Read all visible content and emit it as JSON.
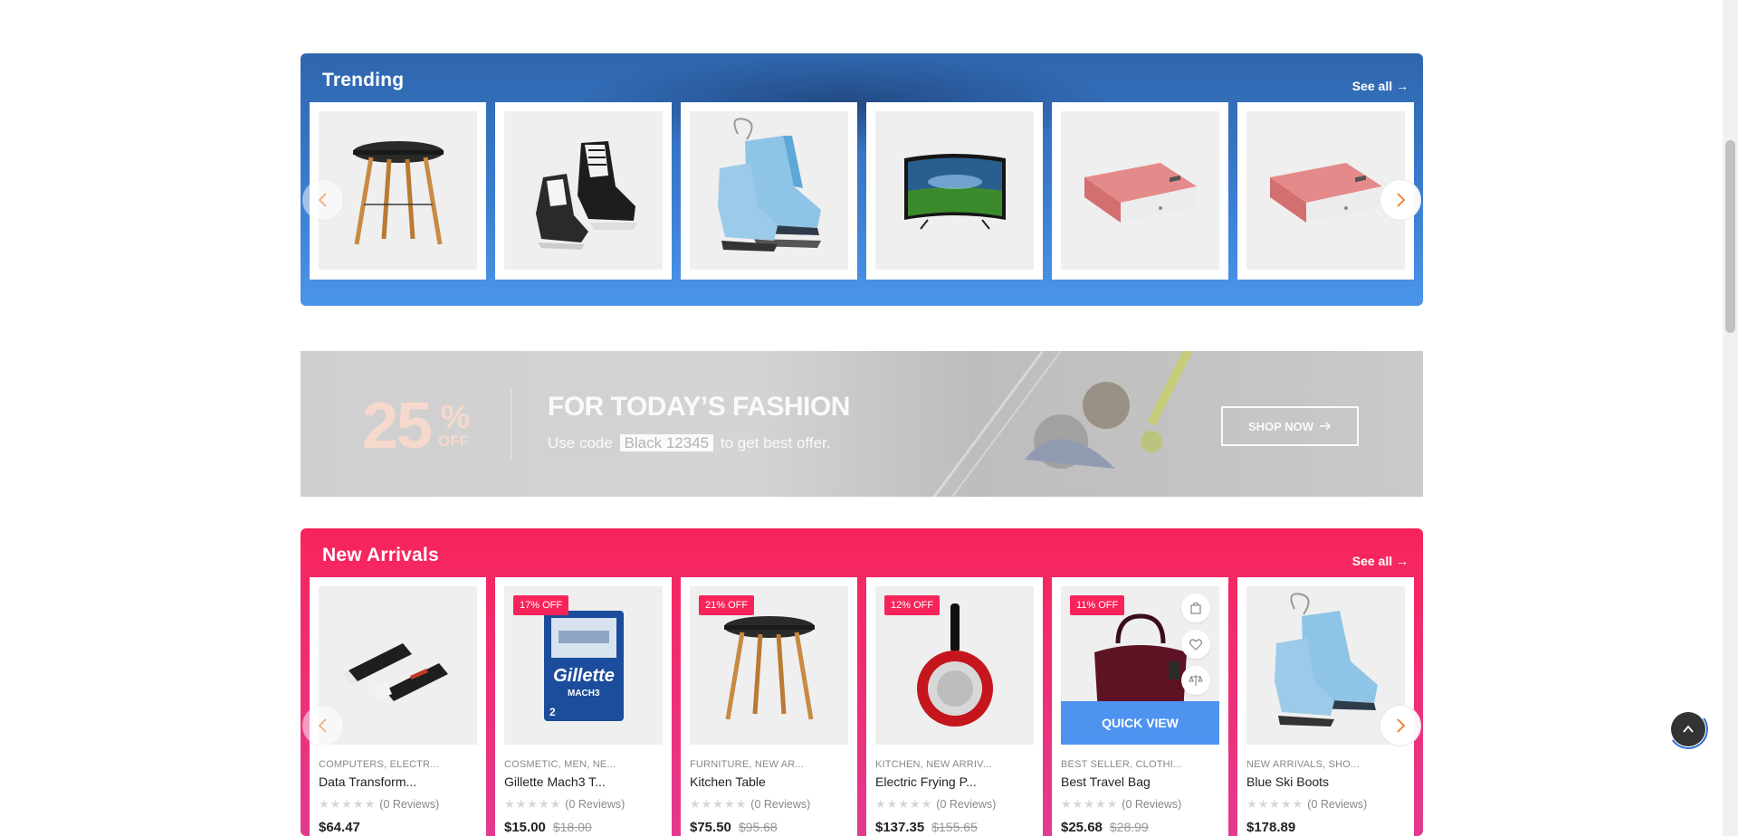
{
  "trending": {
    "title": "Trending",
    "see_all": "See all →",
    "products": [
      {
        "image": "table-image"
      },
      {
        "image": "black-skates-image"
      },
      {
        "image": "blue-skates-image"
      },
      {
        "image": "tv-image"
      },
      {
        "image": "powerbank-image"
      },
      {
        "image": "powerbank-image"
      }
    ]
  },
  "banner": {
    "percent": "25",
    "percent_sign": "%",
    "off": "OFF",
    "headline": "FOR TODAY’S FASHION",
    "sub_before": "Use code",
    "code": "Black 12345",
    "sub_after": "to get best offer.",
    "button": "SHOP NOW"
  },
  "new_arrivals": {
    "title": "New Arrivals",
    "see_all": "See all →",
    "quick_view": "QUICK VIEW",
    "products": [
      {
        "badge": "",
        "category": "COMPUTERS, ELECTR...",
        "name": "Data Transform...",
        "reviews": "(0 Reviews)",
        "price": "$64.47",
        "old_price": ""
      },
      {
        "badge": "17% OFF",
        "category": "COSMETIC, MEN, NE...",
        "name": "Gillette Mach3 T...",
        "reviews": "(0 Reviews)",
        "price": "$15.00",
        "old_price": "$18.00"
      },
      {
        "badge": "21% OFF",
        "category": "FURNITURE, NEW AR...",
        "name": "Kitchen Table",
        "reviews": "(0 Reviews)",
        "price": "$75.50",
        "old_price": "$95.68"
      },
      {
        "badge": "12% OFF",
        "category": "KITCHEN, NEW ARRIV...",
        "name": "Electric Frying P...",
        "reviews": "(0 Reviews)",
        "price": "$137.35",
        "old_price": "$155.65"
      },
      {
        "badge": "11% OFF",
        "category": "BEST SELLER, CLOTHI...",
        "name": "Best Travel Bag",
        "reviews": "(0 Reviews)",
        "price": "$25.68",
        "old_price": "$28.99"
      },
      {
        "badge": "",
        "category": "NEW ARRIVALS, SHO...",
        "name": "Blue Ski Boots",
        "reviews": "(0 Reviews)",
        "price": "$178.89",
        "old_price": ""
      }
    ]
  },
  "colors": {
    "trending_blue": "#3a7ccf",
    "arrivals_pink": "#f7245a",
    "quick_view_blue": "#4d93ef",
    "nav_arrow_orange": "#f07a2b"
  }
}
